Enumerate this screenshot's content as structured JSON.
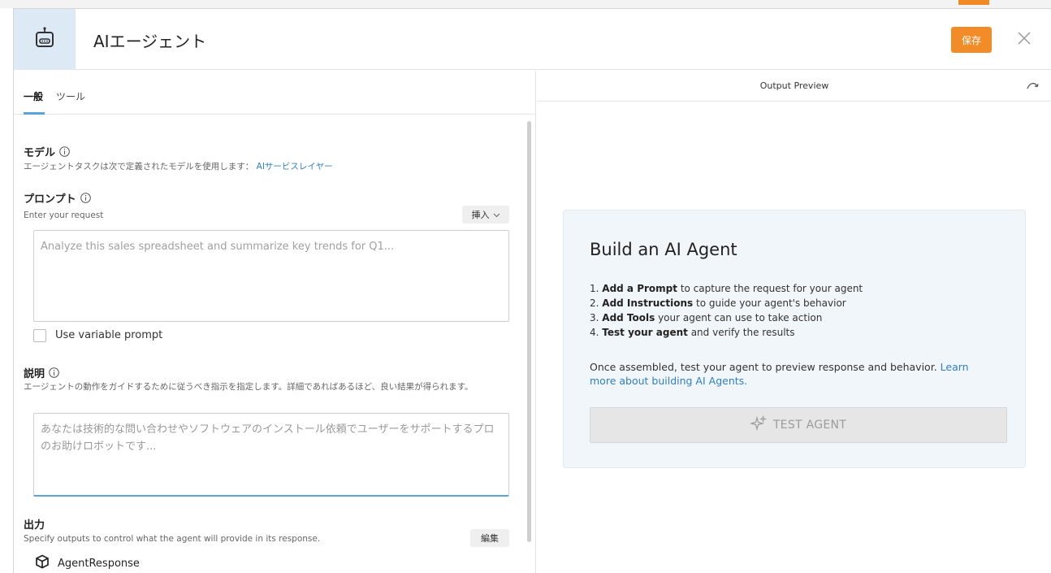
{
  "header": {
    "title": "AIエージェント",
    "save_label": "保存"
  },
  "tabs": [
    {
      "label": "一般"
    },
    {
      "label": "ツール"
    }
  ],
  "model": {
    "label": "モデル",
    "help_prefix": "エージェントタスクは次で定義されたモデルを使用します：",
    "help_link": "AIサービスレイヤー"
  },
  "prompt": {
    "label": "プロンプト",
    "help": "Enter your request",
    "insert_label": "挿入",
    "placeholder": "Analyze this sales spreadsheet and summarize key trends for Q1...",
    "variable_checkbox_label": "Use variable prompt"
  },
  "instructions": {
    "label": "説明",
    "help": "エージェントの動作をガイドするために従うべき指示を指定します。詳細であればあるほど、良い結果が得られます。",
    "placeholder": "あなたは技術的な問い合わせやソフトウェアのインストール依頼でユーザーをサポートするプロのお助けロボットです..."
  },
  "output": {
    "label": "出力",
    "help": "Specify outputs to control what the agent will provide in its response.",
    "edit_label": "編集",
    "item": "AgentResponse"
  },
  "preview": {
    "title": "Output Preview",
    "card_title": "Build an AI Agent",
    "steps": [
      {
        "num": "1.",
        "bold": "Add a Prompt",
        "rest": " to capture the request for your agent"
      },
      {
        "num": "2.",
        "bold": "Add Instructions",
        "rest": " to guide your agent's behavior"
      },
      {
        "num": "3.",
        "bold": "Add Tools",
        "rest": " your agent can use to take action"
      },
      {
        "num": "4.",
        "bold": "Test your agent",
        "rest": " and verify the results"
      }
    ],
    "desc": "Once assembled, test your agent to preview response and behavior.",
    "desc_link": "Learn more about building AI Agents.",
    "test_button": "TEST AGENT"
  },
  "colors": {
    "accent": "#f28c28",
    "link": "#2f7fc1",
    "header_icon_bg": "#dde9f5",
    "card_bg": "#f1f6fa"
  },
  "icons": {
    "header": "robot-icon",
    "close": "close-icon",
    "info": "info-icon",
    "chevron": "chevron-down-icon",
    "refresh": "refresh-icon",
    "sparkle": "sparkle-icon",
    "output": "box-icon"
  }
}
